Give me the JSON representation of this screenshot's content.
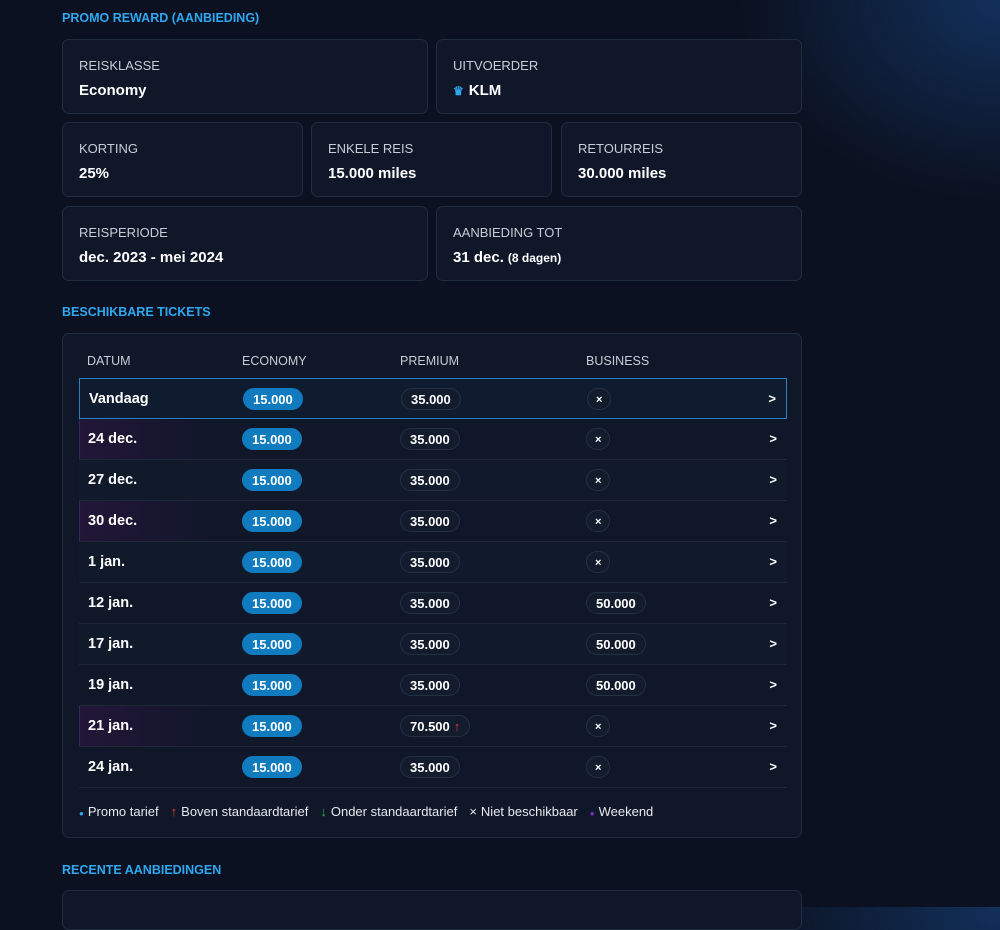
{
  "sections": {
    "promo": "PROMO REWARD (AANBIEDING)",
    "tickets": "BESCHIKBARE TICKETS",
    "recent": "RECENTE AANBIEDINGEN"
  },
  "info": {
    "reisklasse": {
      "label": "REISKLASSE",
      "value": "Economy"
    },
    "uitvoerder": {
      "label": "UITVOERDER",
      "value": "KLM",
      "icon": "crown-icon"
    },
    "korting": {
      "label": "KORTING",
      "value": "25%"
    },
    "enkele": {
      "label": "ENKELE REIS",
      "value": "15.000 miles"
    },
    "retour": {
      "label": "RETOURREIS",
      "value": "30.000 miles"
    },
    "periode": {
      "label": "REISPERIODE",
      "value": "dec. 2023 - mei 2024"
    },
    "tot": {
      "label": "AANBIEDING TOT",
      "value": "31 dec.",
      "extra": "(8 dagen)"
    }
  },
  "table": {
    "headers": [
      "DATUM",
      "ECONOMY",
      "PREMIUM",
      "BUSINESS"
    ],
    "rows": [
      {
        "date": "Vandaag",
        "economy": "15.000",
        "premium": "35.000",
        "business": "×",
        "selected": true,
        "weekend": false
      },
      {
        "date": "24 dec.",
        "economy": "15.000",
        "premium": "35.000",
        "business": "×",
        "weekend": true
      },
      {
        "date": "27 dec.",
        "economy": "15.000",
        "premium": "35.000",
        "business": "×",
        "weekend": false
      },
      {
        "date": "30 dec.",
        "economy": "15.000",
        "premium": "35.000",
        "business": "×",
        "weekend": true
      },
      {
        "date": "1 jan.",
        "economy": "15.000",
        "premium": "35.000",
        "business": "×",
        "weekend": false
      },
      {
        "date": "12 jan.",
        "economy": "15.000",
        "premium": "35.000",
        "business": "50.000",
        "weekend": false
      },
      {
        "date": "17 jan.",
        "economy": "15.000",
        "premium": "35.000",
        "business": "50.000",
        "weekend": false
      },
      {
        "date": "19 jan.",
        "economy": "15.000",
        "premium": "35.000",
        "business": "50.000",
        "weekend": false
      },
      {
        "date": "21 jan.",
        "economy": "15.000",
        "premium": "70.500",
        "premium_trend": "↑",
        "business": "×",
        "weekend": true
      },
      {
        "date": "24 jan.",
        "economy": "15.000",
        "premium": "35.000",
        "business": "×",
        "weekend": false
      }
    ],
    "row_action": ">"
  },
  "legend": [
    {
      "symbol": "●",
      "label": "Promo tarief",
      "color": "#2ea8f0"
    },
    {
      "symbol": "↑",
      "label": "Boven standaardtarief",
      "color": "#e23b3b"
    },
    {
      "symbol": "↓",
      "label": "Onder standaardtarief",
      "color": "#22b14c"
    },
    {
      "symbol": "×",
      "label": "Niet beschikbaar",
      "color": "#e6e9ee"
    },
    {
      "symbol": "●",
      "label": "Weekend",
      "color": "#7b2fd0"
    }
  ]
}
